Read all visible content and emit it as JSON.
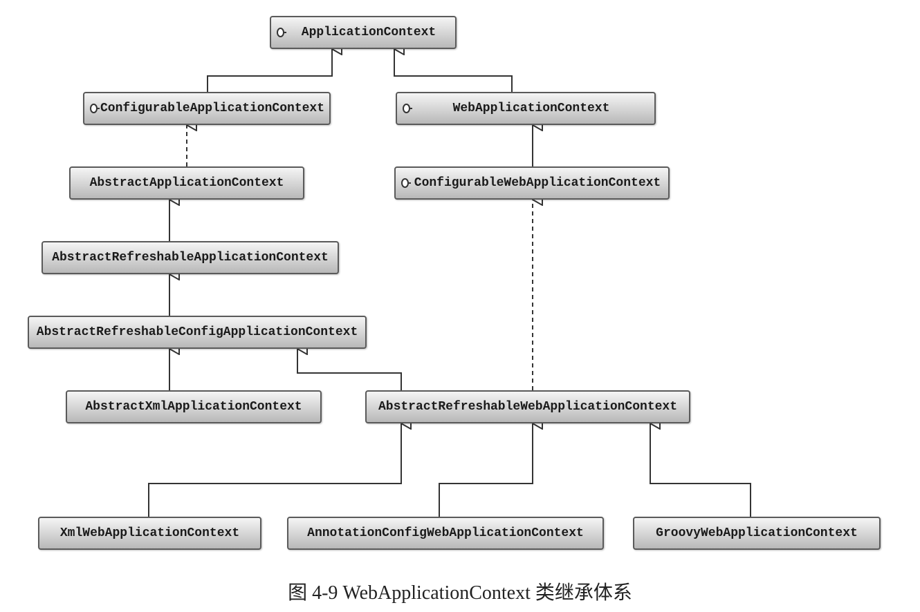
{
  "diagram": {
    "caption": "图 4-9  WebApplicationContext 类继承体系",
    "nodes": {
      "applicationContext": {
        "label": "ApplicationContext",
        "interface": true
      },
      "configurableApplicationContext": {
        "label": "ConfigurableApplicationContext",
        "interface": true
      },
      "webApplicationContext": {
        "label": "WebApplicationContext",
        "interface": true
      },
      "abstractApplicationContext": {
        "label": "AbstractApplicationContext",
        "interface": false
      },
      "configurableWebApplicationContext": {
        "label": "ConfigurableWebApplicationContext",
        "interface": true
      },
      "abstractRefreshableApplicationContext": {
        "label": "AbstractRefreshableApplicationContext",
        "interface": false
      },
      "abstractRefreshableConfigApplicationContext": {
        "label": "AbstractRefreshableConfigApplicationContext",
        "interface": false
      },
      "abstractXmlApplicationContext": {
        "label": "AbstractXmlApplicationContext",
        "interface": false
      },
      "abstractRefreshableWebApplicationContext": {
        "label": "AbstractRefreshableWebApplicationContext",
        "interface": false
      },
      "xmlWebApplicationContext": {
        "label": "XmlWebApplicationContext",
        "interface": false
      },
      "annotationConfigWebApplicationContext": {
        "label": "AnnotationConfigWebApplicationContext",
        "interface": false
      },
      "groovyWebApplicationContext": {
        "label": "GroovyWebApplicationContext",
        "interface": false
      }
    },
    "edges": [
      {
        "from": "configurableApplicationContext",
        "to": "applicationContext",
        "style": "solid"
      },
      {
        "from": "webApplicationContext",
        "to": "applicationContext",
        "style": "solid"
      },
      {
        "from": "abstractApplicationContext",
        "to": "configurableApplicationContext",
        "style": "dashed"
      },
      {
        "from": "configurableWebApplicationContext",
        "to": "webApplicationContext",
        "style": "solid"
      },
      {
        "from": "abstractRefreshableApplicationContext",
        "to": "abstractApplicationContext",
        "style": "solid"
      },
      {
        "from": "abstractRefreshableConfigApplicationContext",
        "to": "abstractRefreshableApplicationContext",
        "style": "solid"
      },
      {
        "from": "abstractXmlApplicationContext",
        "to": "abstractRefreshableConfigApplicationContext",
        "style": "solid"
      },
      {
        "from": "abstractRefreshableWebApplicationContext",
        "to": "abstractRefreshableConfigApplicationContext",
        "style": "solid"
      },
      {
        "from": "abstractRefreshableWebApplicationContext",
        "to": "configurableWebApplicationContext",
        "style": "dashed"
      },
      {
        "from": "xmlWebApplicationContext",
        "to": "abstractRefreshableWebApplicationContext",
        "style": "solid"
      },
      {
        "from": "annotationConfigWebApplicationContext",
        "to": "abstractRefreshableWebApplicationContext",
        "style": "solid"
      },
      {
        "from": "groovyWebApplicationContext",
        "to": "abstractRefreshableWebApplicationContext",
        "style": "solid"
      }
    ]
  }
}
